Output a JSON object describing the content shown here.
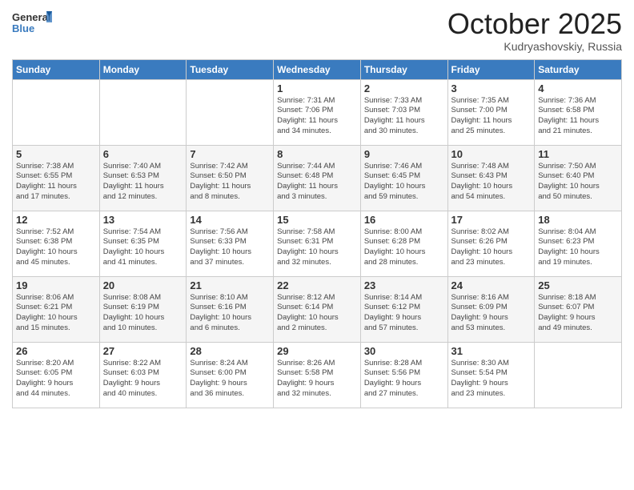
{
  "header": {
    "logo_general": "General",
    "logo_blue": "Blue",
    "month": "October 2025",
    "location": "Kudryashovskiy, Russia"
  },
  "weekdays": [
    "Sunday",
    "Monday",
    "Tuesday",
    "Wednesday",
    "Thursday",
    "Friday",
    "Saturday"
  ],
  "weeks": [
    [
      {
        "day": "",
        "info": ""
      },
      {
        "day": "",
        "info": ""
      },
      {
        "day": "",
        "info": ""
      },
      {
        "day": "1",
        "info": "Sunrise: 7:31 AM\nSunset: 7:06 PM\nDaylight: 11 hours\nand 34 minutes."
      },
      {
        "day": "2",
        "info": "Sunrise: 7:33 AM\nSunset: 7:03 PM\nDaylight: 11 hours\nand 30 minutes."
      },
      {
        "day": "3",
        "info": "Sunrise: 7:35 AM\nSunset: 7:00 PM\nDaylight: 11 hours\nand 25 minutes."
      },
      {
        "day": "4",
        "info": "Sunrise: 7:36 AM\nSunset: 6:58 PM\nDaylight: 11 hours\nand 21 minutes."
      }
    ],
    [
      {
        "day": "5",
        "info": "Sunrise: 7:38 AM\nSunset: 6:55 PM\nDaylight: 11 hours\nand 17 minutes."
      },
      {
        "day": "6",
        "info": "Sunrise: 7:40 AM\nSunset: 6:53 PM\nDaylight: 11 hours\nand 12 minutes."
      },
      {
        "day": "7",
        "info": "Sunrise: 7:42 AM\nSunset: 6:50 PM\nDaylight: 11 hours\nand 8 minutes."
      },
      {
        "day": "8",
        "info": "Sunrise: 7:44 AM\nSunset: 6:48 PM\nDaylight: 11 hours\nand 3 minutes."
      },
      {
        "day": "9",
        "info": "Sunrise: 7:46 AM\nSunset: 6:45 PM\nDaylight: 10 hours\nand 59 minutes."
      },
      {
        "day": "10",
        "info": "Sunrise: 7:48 AM\nSunset: 6:43 PM\nDaylight: 10 hours\nand 54 minutes."
      },
      {
        "day": "11",
        "info": "Sunrise: 7:50 AM\nSunset: 6:40 PM\nDaylight: 10 hours\nand 50 minutes."
      }
    ],
    [
      {
        "day": "12",
        "info": "Sunrise: 7:52 AM\nSunset: 6:38 PM\nDaylight: 10 hours\nand 45 minutes."
      },
      {
        "day": "13",
        "info": "Sunrise: 7:54 AM\nSunset: 6:35 PM\nDaylight: 10 hours\nand 41 minutes."
      },
      {
        "day": "14",
        "info": "Sunrise: 7:56 AM\nSunset: 6:33 PM\nDaylight: 10 hours\nand 37 minutes."
      },
      {
        "day": "15",
        "info": "Sunrise: 7:58 AM\nSunset: 6:31 PM\nDaylight: 10 hours\nand 32 minutes."
      },
      {
        "day": "16",
        "info": "Sunrise: 8:00 AM\nSunset: 6:28 PM\nDaylight: 10 hours\nand 28 minutes."
      },
      {
        "day": "17",
        "info": "Sunrise: 8:02 AM\nSunset: 6:26 PM\nDaylight: 10 hours\nand 23 minutes."
      },
      {
        "day": "18",
        "info": "Sunrise: 8:04 AM\nSunset: 6:23 PM\nDaylight: 10 hours\nand 19 minutes."
      }
    ],
    [
      {
        "day": "19",
        "info": "Sunrise: 8:06 AM\nSunset: 6:21 PM\nDaylight: 10 hours\nand 15 minutes."
      },
      {
        "day": "20",
        "info": "Sunrise: 8:08 AM\nSunset: 6:19 PM\nDaylight: 10 hours\nand 10 minutes."
      },
      {
        "day": "21",
        "info": "Sunrise: 8:10 AM\nSunset: 6:16 PM\nDaylight: 10 hours\nand 6 minutes."
      },
      {
        "day": "22",
        "info": "Sunrise: 8:12 AM\nSunset: 6:14 PM\nDaylight: 10 hours\nand 2 minutes."
      },
      {
        "day": "23",
        "info": "Sunrise: 8:14 AM\nSunset: 6:12 PM\nDaylight: 9 hours\nand 57 minutes."
      },
      {
        "day": "24",
        "info": "Sunrise: 8:16 AM\nSunset: 6:09 PM\nDaylight: 9 hours\nand 53 minutes."
      },
      {
        "day": "25",
        "info": "Sunrise: 8:18 AM\nSunset: 6:07 PM\nDaylight: 9 hours\nand 49 minutes."
      }
    ],
    [
      {
        "day": "26",
        "info": "Sunrise: 8:20 AM\nSunset: 6:05 PM\nDaylight: 9 hours\nand 44 minutes."
      },
      {
        "day": "27",
        "info": "Sunrise: 8:22 AM\nSunset: 6:03 PM\nDaylight: 9 hours\nand 40 minutes."
      },
      {
        "day": "28",
        "info": "Sunrise: 8:24 AM\nSunset: 6:00 PM\nDaylight: 9 hours\nand 36 minutes."
      },
      {
        "day": "29",
        "info": "Sunrise: 8:26 AM\nSunset: 5:58 PM\nDaylight: 9 hours\nand 32 minutes."
      },
      {
        "day": "30",
        "info": "Sunrise: 8:28 AM\nSunset: 5:56 PM\nDaylight: 9 hours\nand 27 minutes."
      },
      {
        "day": "31",
        "info": "Sunrise: 8:30 AM\nSunset: 5:54 PM\nDaylight: 9 hours\nand 23 minutes."
      },
      {
        "day": "",
        "info": ""
      }
    ]
  ]
}
